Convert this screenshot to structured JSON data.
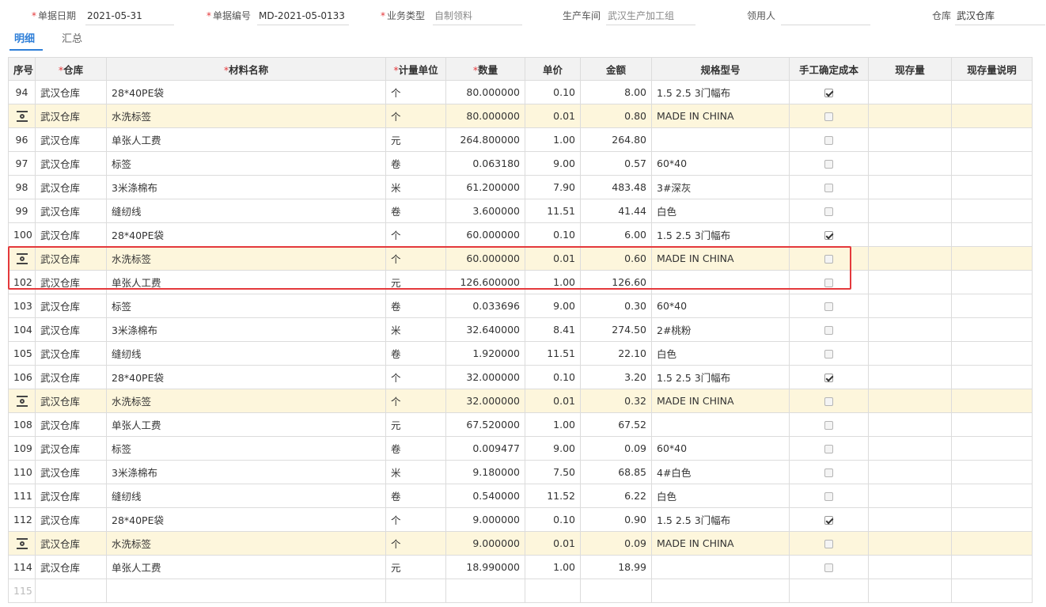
{
  "header": {
    "date_label": "单据日期",
    "date_value": "2021-05-31",
    "docno_label": "单据编号",
    "docno_value": "MD-2021-05-0133",
    "biztype_label": "业务类型",
    "biztype_value": "自制领料",
    "workshop_label": "生产车间",
    "workshop_value": "武汉生产加工组",
    "receiver_label": "领用人",
    "receiver_value": "",
    "warehouse_label": "仓库",
    "warehouse_value": "武汉仓库"
  },
  "tabs": [
    {
      "label": "明细"
    },
    {
      "label": "汇总"
    }
  ],
  "columns": {
    "seq": "序号",
    "warehouse": "仓库",
    "material": "材料名称",
    "unit": "计量单位",
    "qty": "数量",
    "price": "单价",
    "amount": "金额",
    "spec": "规格型号",
    "manual_cost": "手工确定成本",
    "stock": "现存量",
    "stock_note": "现存量说明"
  },
  "rows": [
    {
      "seq": "94",
      "warehouse": "武汉仓库",
      "material": "28*40PE袋",
      "unit": "个",
      "qty": "80.000000",
      "price": "0.10",
      "amount": "8.00",
      "spec": "1.5  2.5  3门幅布",
      "checked": true,
      "highlight": false
    },
    {
      "seq": "",
      "warehouse": "武汉仓库",
      "material": "水洗标签",
      "unit": "个",
      "qty": "80.000000",
      "price": "0.01",
      "amount": "0.80",
      "spec": "MADE IN CHINA",
      "checked": false,
      "highlight": true
    },
    {
      "seq": "96",
      "warehouse": "武汉仓库",
      "material": "单张人工费",
      "unit": "元",
      "qty": "264.800000",
      "price": "1.00",
      "amount": "264.80",
      "spec": "",
      "checked": false,
      "highlight": false
    },
    {
      "seq": "97",
      "warehouse": "武汉仓库",
      "material": "标签",
      "unit": "卷",
      "qty": "0.063180",
      "price": "9.00",
      "amount": "0.57",
      "spec": "60*40",
      "checked": false,
      "highlight": false
    },
    {
      "seq": "98",
      "warehouse": "武汉仓库",
      "material": "3米涤棉布",
      "unit": "米",
      "qty": "61.200000",
      "price": "7.90",
      "amount": "483.48",
      "spec": "3#深灰",
      "checked": false,
      "highlight": false
    },
    {
      "seq": "99",
      "warehouse": "武汉仓库",
      "material": "缝纫线",
      "unit": "卷",
      "qty": "3.600000",
      "price": "11.51",
      "amount": "41.44",
      "spec": "白色",
      "checked": false,
      "highlight": false
    },
    {
      "seq": "100",
      "warehouse": "武汉仓库",
      "material": "28*40PE袋",
      "unit": "个",
      "qty": "60.000000",
      "price": "0.10",
      "amount": "6.00",
      "spec": "1.5  2.5  3门幅布",
      "checked": true,
      "highlight": false
    },
    {
      "seq": "",
      "warehouse": "武汉仓库",
      "material": "水洗标签",
      "unit": "个",
      "qty": "60.000000",
      "price": "0.01",
      "amount": "0.60",
      "spec": "MADE IN CHINA",
      "checked": false,
      "highlight": true
    },
    {
      "seq": "102",
      "warehouse": "武汉仓库",
      "material": "单张人工费",
      "unit": "元",
      "qty": "126.600000",
      "price": "1.00",
      "amount": "126.60",
      "spec": "",
      "checked": false,
      "highlight": false
    },
    {
      "seq": "103",
      "warehouse": "武汉仓库",
      "material": "标签",
      "unit": "卷",
      "qty": "0.033696",
      "price": "9.00",
      "amount": "0.30",
      "spec": "60*40",
      "checked": false,
      "highlight": false
    },
    {
      "seq": "104",
      "warehouse": "武汉仓库",
      "material": "3米涤棉布",
      "unit": "米",
      "qty": "32.640000",
      "price": "8.41",
      "amount": "274.50",
      "spec": "2#桃粉",
      "checked": false,
      "highlight": false
    },
    {
      "seq": "105",
      "warehouse": "武汉仓库",
      "material": "缝纫线",
      "unit": "卷",
      "qty": "1.920000",
      "price": "11.51",
      "amount": "22.10",
      "spec": "白色",
      "checked": false,
      "highlight": false
    },
    {
      "seq": "106",
      "warehouse": "武汉仓库",
      "material": "28*40PE袋",
      "unit": "个",
      "qty": "32.000000",
      "price": "0.10",
      "amount": "3.20",
      "spec": "1.5  2.5  3门幅布",
      "checked": true,
      "highlight": false
    },
    {
      "seq": "",
      "warehouse": "武汉仓库",
      "material": "水洗标签",
      "unit": "个",
      "qty": "32.000000",
      "price": "0.01",
      "amount": "0.32",
      "spec": "MADE IN CHINA",
      "checked": false,
      "highlight": true
    },
    {
      "seq": "108",
      "warehouse": "武汉仓库",
      "material": "单张人工费",
      "unit": "元",
      "qty": "67.520000",
      "price": "1.00",
      "amount": "67.52",
      "spec": "",
      "checked": false,
      "highlight": false
    },
    {
      "seq": "109",
      "warehouse": "武汉仓库",
      "material": "标签",
      "unit": "卷",
      "qty": "0.009477",
      "price": "9.00",
      "amount": "0.09",
      "spec": "60*40",
      "checked": false,
      "highlight": false
    },
    {
      "seq": "110",
      "warehouse": "武汉仓库",
      "material": "3米涤棉布",
      "unit": "米",
      "qty": "9.180000",
      "price": "7.50",
      "amount": "68.85",
      "spec": "4#白色",
      "checked": false,
      "highlight": false
    },
    {
      "seq": "111",
      "warehouse": "武汉仓库",
      "material": "缝纫线",
      "unit": "卷",
      "qty": "0.540000",
      "price": "11.52",
      "amount": "6.22",
      "spec": "白色",
      "checked": false,
      "highlight": false
    },
    {
      "seq": "112",
      "warehouse": "武汉仓库",
      "material": "28*40PE袋",
      "unit": "个",
      "qty": "9.000000",
      "price": "0.10",
      "amount": "0.90",
      "spec": "1.5  2.5  3门幅布",
      "checked": true,
      "highlight": false
    },
    {
      "seq": "",
      "warehouse": "武汉仓库",
      "material": "水洗标签",
      "unit": "个",
      "qty": "9.000000",
      "price": "0.01",
      "amount": "0.09",
      "spec": "MADE IN CHINA",
      "checked": false,
      "highlight": true
    },
    {
      "seq": "114",
      "warehouse": "武汉仓库",
      "material": "单张人工费",
      "unit": "元",
      "qty": "18.990000",
      "price": "1.00",
      "amount": "18.99",
      "spec": "",
      "checked": false,
      "highlight": false
    }
  ],
  "empty_row_seq": "115",
  "colors": {
    "accent": "#2f7fd8",
    "required": "#e4393c",
    "highlight_row": "#fdf6dc",
    "selection_box": "#e4393c"
  }
}
